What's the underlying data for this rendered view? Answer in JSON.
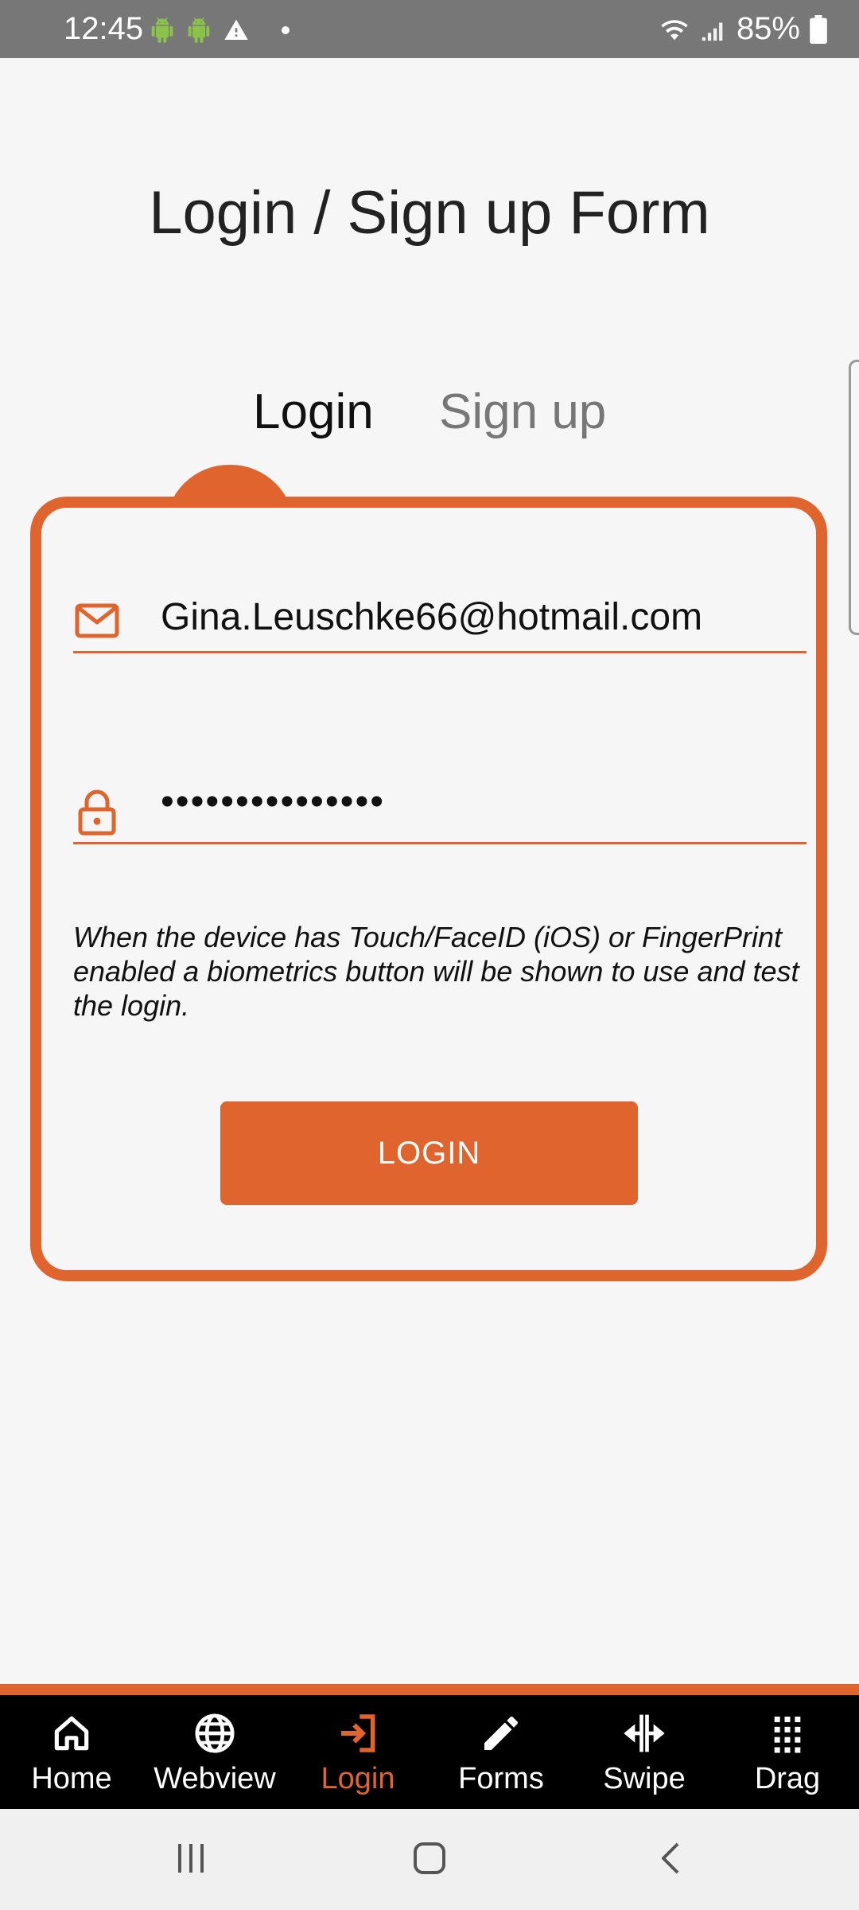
{
  "status_bar": {
    "time": "12:45",
    "battery": "85%"
  },
  "page": {
    "title": "Login / Sign up Form"
  },
  "tabs": [
    {
      "label": "Login",
      "active": true
    },
    {
      "label": "Sign up",
      "active": false
    }
  ],
  "form": {
    "email_value": "Gina.Leuschke66@hotmail.com",
    "password_value": "•••••••••••••••",
    "biometrics_note": "When the device has Touch/FaceID (iOS) or FingerPrint enabled a biometrics button will be shown to use and test the login.",
    "login_button_label": "LOGIN"
  },
  "bottom_nav": {
    "items": [
      {
        "label": "Home",
        "icon": "home-icon"
      },
      {
        "label": "Webview",
        "icon": "globe-icon"
      },
      {
        "label": "Login",
        "icon": "login-icon",
        "active": true
      },
      {
        "label": "Forms",
        "icon": "pencil-icon"
      },
      {
        "label": "Swipe",
        "icon": "swipe-icon"
      },
      {
        "label": "Drag",
        "icon": "grid-dots-icon"
      }
    ]
  },
  "colors": {
    "accent": "#e0642d",
    "background": "#f6f6f6",
    "status_bar": "#777777",
    "nav_background": "#000000"
  }
}
